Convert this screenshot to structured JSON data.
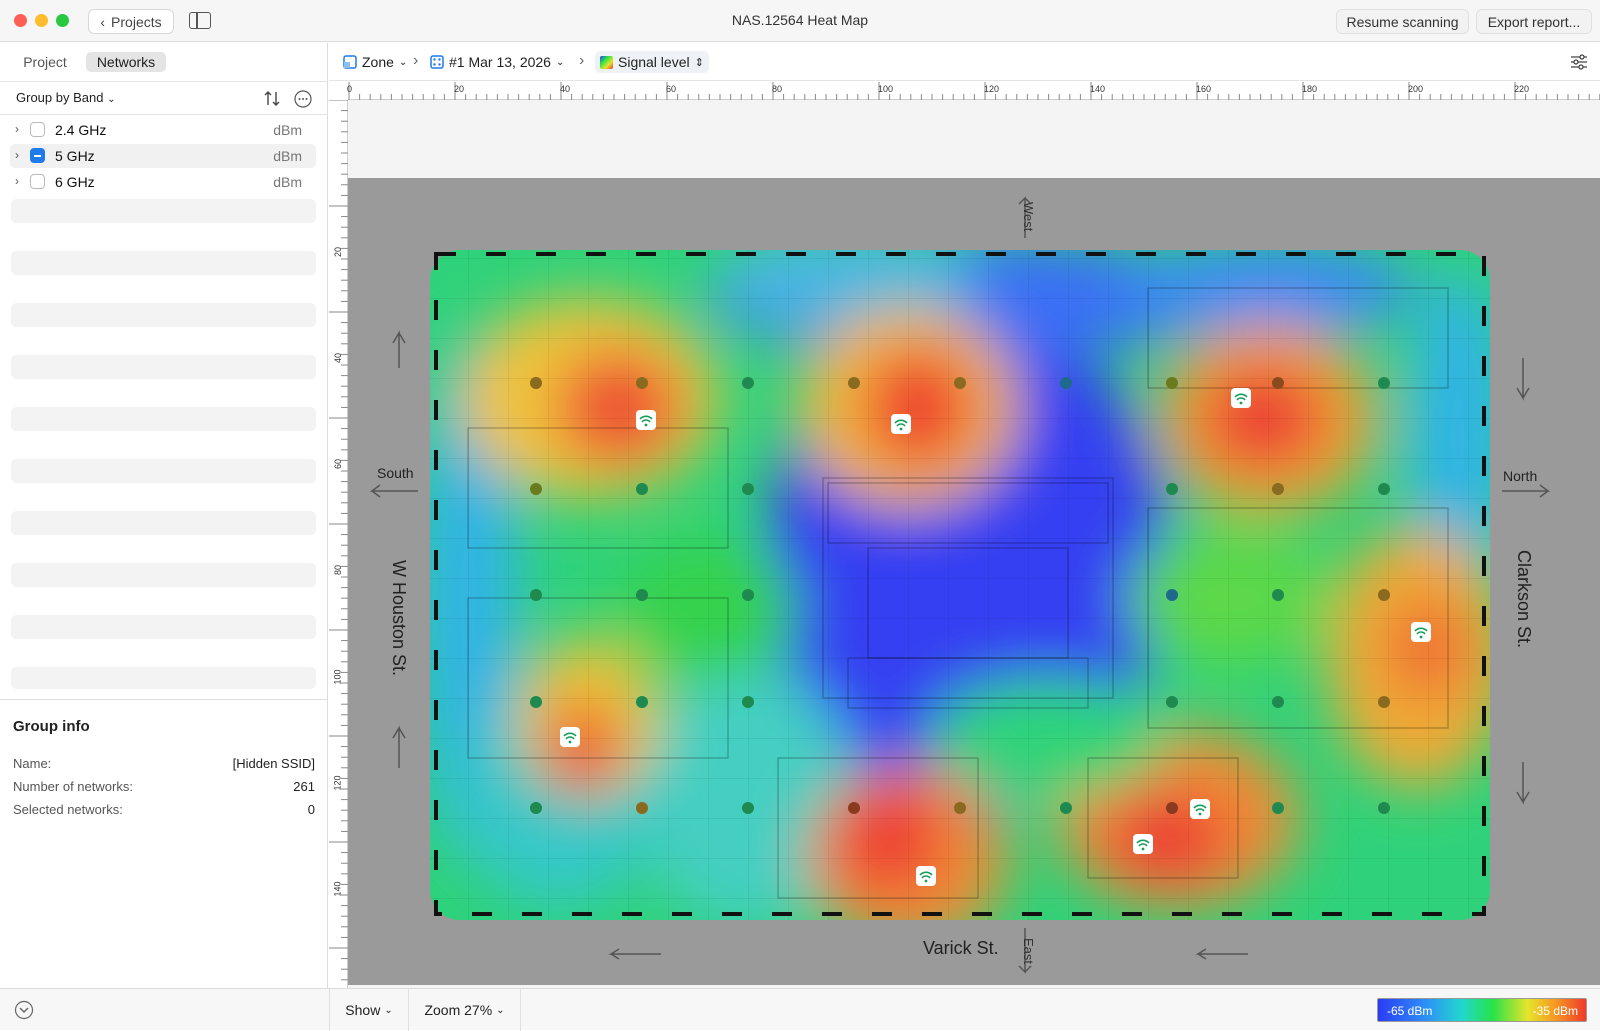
{
  "window": {
    "title": "NAS.12564 Heat Map"
  },
  "toolbar": {
    "back_label": "Projects",
    "resume_label": "Resume scanning",
    "export_label": "Export report..."
  },
  "sidebar": {
    "tabs": [
      {
        "label": "Project"
      },
      {
        "label": "Networks"
      }
    ],
    "group_by": "Group by Band",
    "bands": [
      {
        "label": "2.4 GHz",
        "unit": "dBm",
        "state": "unchecked"
      },
      {
        "label": "5 GHz",
        "unit": "dBm",
        "state": "mixed"
      },
      {
        "label": "6 GHz",
        "unit": "dBm",
        "state": "unchecked"
      }
    ],
    "group_info": {
      "title": "Group info",
      "rows": [
        {
          "label": "Name:",
          "value": "[Hidden SSID]"
        },
        {
          "label": "Number of networks:",
          "value": "261"
        },
        {
          "label": "Selected networks:",
          "value": "0"
        }
      ]
    }
  },
  "breadcrumbs": {
    "zone": "Zone",
    "scan": "#1 Mar 13, 2026",
    "view": "Signal level"
  },
  "rulers": {
    "h_labels": [
      "0",
      "20",
      "40",
      "60",
      "80",
      "100",
      "120",
      "140",
      "160",
      "180",
      "200",
      "220"
    ],
    "v_labels": [
      "20",
      "40",
      "60",
      "80",
      "100",
      "120",
      "140"
    ]
  },
  "map": {
    "labels": {
      "west": "West",
      "east": "East",
      "south": "South",
      "north": "North",
      "left_street": "W Houston St.",
      "right_street": "Clarkson St.",
      "bottom_street": "Varick St."
    }
  },
  "bottombar": {
    "show_label": "Show",
    "zoom_label": "Zoom 27%"
  },
  "legend": {
    "min": "-65 dBm",
    "max": "-35 dBm"
  },
  "colors": {
    "accent": "#1f7aea",
    "close": "#ff5f57",
    "minimize": "#febc2e",
    "zoom": "#28c840",
    "map_background": "#9a9a9a"
  }
}
